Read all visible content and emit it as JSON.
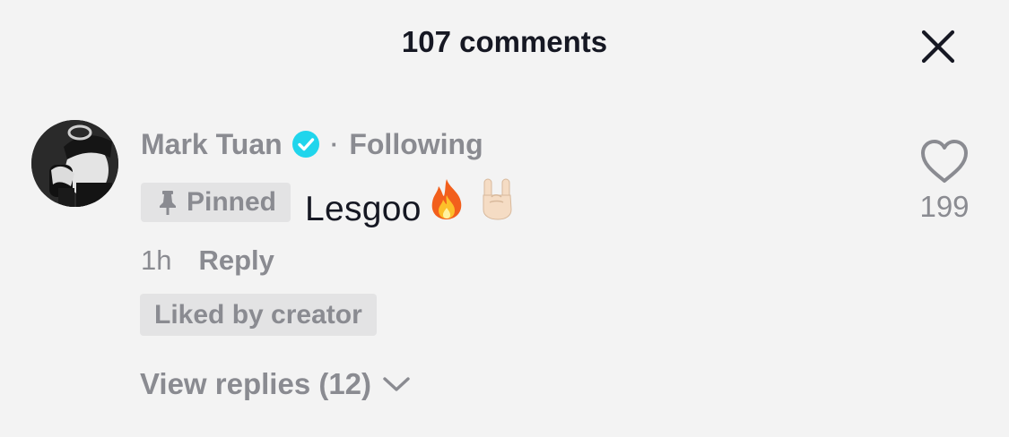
{
  "header": {
    "title": "107 comments",
    "close_icon": "close-icon"
  },
  "comment": {
    "author": "Mark Tuan",
    "verified_icon": "verified-badge-icon",
    "separator": "·",
    "follow_status": "Following",
    "pinned_label": "Pinned",
    "text": "Lesgoo",
    "emojis": [
      "fire-emoji",
      "rock-on-hand-emoji"
    ],
    "time": "1h",
    "reply_label": "Reply",
    "liked_by_creator_label": "Liked by creator",
    "view_replies_label": "View replies (12)",
    "like_count": "199"
  },
  "colors": {
    "background": "#f3f3f3",
    "primary_text": "#161823",
    "secondary_text": "#8a8b91",
    "badge_background": "#e3e3e4",
    "verified_blue": "#20d5ec"
  }
}
